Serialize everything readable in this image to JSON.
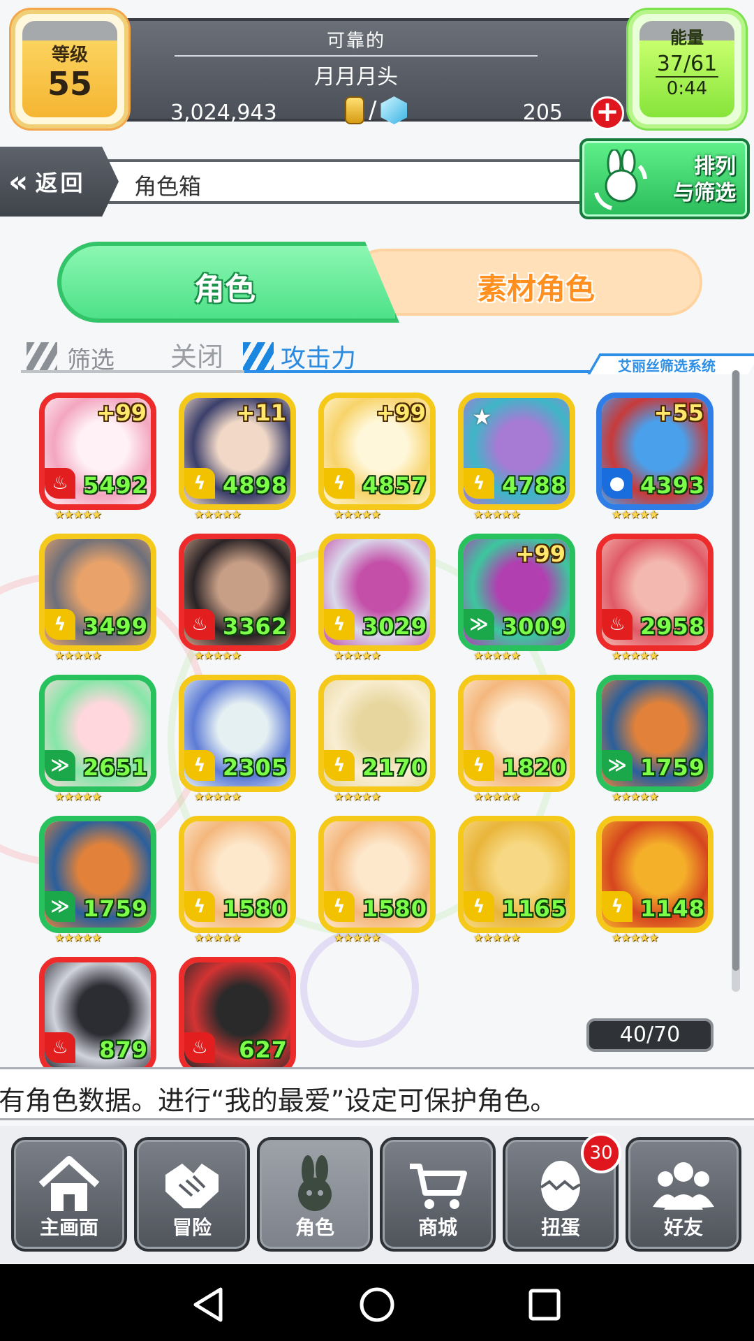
{
  "hud": {
    "level_label": "等级",
    "level_value": "55",
    "title_sub": "可靠的",
    "player_name": "月月月头",
    "coins": "3,024,943",
    "currency_sep": "/",
    "gems": "205",
    "energy_label": "能量",
    "energy_count": "37/61",
    "energy_timer": "0:44"
  },
  "header": {
    "back_label": "返回",
    "title": "角色箱",
    "sort_label_line1": "排列",
    "sort_label_line2": "与筛选"
  },
  "tabs": {
    "characters": "角色",
    "materials": "素材角色"
  },
  "filter": {
    "label": "筛选",
    "state": "关闭",
    "sort_key": "攻击力",
    "system_label": "艾丽丝筛选系统"
  },
  "characters": [
    {
      "power": "5492",
      "plus": "+99",
      "frame": "#ee2b2b",
      "element": "fire",
      "art": "#f3a6bf",
      "art2": "#fff1f5"
    },
    {
      "power": "4898",
      "plus": "+11",
      "frame": "#f5c91a",
      "element": "thunder",
      "art": "#3b3f6b",
      "art2": "#f2d9c7"
    },
    {
      "power": "4857",
      "plus": "+99",
      "frame": "#f5c91a",
      "element": "thunder",
      "art": "#f7d36a",
      "art2": "#fff7d9"
    },
    {
      "power": "4788",
      "plus": "",
      "frame": "#f5c91a",
      "element": "thunder",
      "art": "#3fb6c7",
      "art2": "#a77ad4",
      "favorite": "★"
    },
    {
      "power": "4393",
      "plus": "+55",
      "frame": "#2f7de6",
      "element": "water",
      "art": "#c83a3a",
      "art2": "#4aa0ea"
    },
    {
      "power": "3499",
      "plus": "",
      "frame": "#f5c91a",
      "element": "thunder",
      "art": "#6d6f7a",
      "art2": "#e9a36a"
    },
    {
      "power": "3362",
      "plus": "",
      "frame": "#ee2b2b",
      "element": "fire",
      "art": "#2a2326",
      "art2": "#c79e86"
    },
    {
      "power": "3029",
      "plus": "",
      "frame": "#f5c91a",
      "element": "thunder",
      "art": "#d9d9ea",
      "art2": "#c44fa8"
    },
    {
      "power": "3009",
      "plus": "+99",
      "frame": "#27c25e",
      "element": "wind",
      "art": "#3cc79e",
      "art2": "#b13fb0"
    },
    {
      "power": "2958",
      "plus": "",
      "frame": "#ee2b2b",
      "element": "fire",
      "art": "#e05a66",
      "art2": "#f3b9b0"
    },
    {
      "power": "2651",
      "plus": "",
      "frame": "#27c25e",
      "element": "wind",
      "art": "#85e6a7",
      "art2": "#ffd7dd"
    },
    {
      "power": "2305",
      "plus": "",
      "frame": "#f5c91a",
      "element": "thunder",
      "art": "#5d7bd6",
      "art2": "#e5f0f3"
    },
    {
      "power": "2170",
      "plus": "",
      "frame": "#f5c91a",
      "element": "thunder",
      "art": "#f9eed2",
      "art2": "#e7d69e"
    },
    {
      "power": "1820",
      "plus": "",
      "frame": "#f5c91a",
      "element": "thunder",
      "art": "#f4b77d",
      "art2": "#fde8cc"
    },
    {
      "power": "1759",
      "plus": "",
      "frame": "#27c25e",
      "element": "wind",
      "art": "#2a5f9c",
      "art2": "#e2823a"
    },
    {
      "power": "1759",
      "plus": "",
      "frame": "#27c25e",
      "element": "wind",
      "art": "#2a5f9c",
      "art2": "#e2823a"
    },
    {
      "power": "1580",
      "plus": "",
      "frame": "#f5c91a",
      "element": "thunder",
      "art": "#f4b77d",
      "art2": "#fde8cc"
    },
    {
      "power": "1580",
      "plus": "",
      "frame": "#f5c91a",
      "element": "thunder",
      "art": "#f4b77d",
      "art2": "#fde8cc"
    },
    {
      "power": "1165",
      "plus": "",
      "frame": "#f5c91a",
      "element": "thunder",
      "art": "#e9b53a",
      "art2": "#f7d985"
    },
    {
      "power": "1148",
      "plus": "",
      "frame": "#f5c91a",
      "element": "thunder",
      "art": "#d6451f",
      "art2": "#f5b02a"
    },
    {
      "power": "879",
      "plus": "",
      "frame": "#ee2b2b",
      "element": "fire",
      "art": "#d0d2dc",
      "art2": "#2c2c33"
    },
    {
      "power": "627",
      "plus": "",
      "frame": "#ee2b2b",
      "element": "fire",
      "art": "#d43333",
      "art2": "#2a2a2a"
    }
  ],
  "element_glyphs": {
    "fire": "♨",
    "thunder": "ϟ",
    "water": "●",
    "wind": "≫"
  },
  "element_colors": {
    "fire": "#e21e1e",
    "thunder": "#f2c200",
    "water": "#1a6ddc",
    "wind": "#1aa84a"
  },
  "rarity_stars": "★★★★★",
  "box_count": "40/70",
  "message": "有角色数据。进行“我的最爱”设定可保护角色。",
  "nav": {
    "home": "主画面",
    "adventure": "冒险",
    "characters": "角色",
    "shop": "商城",
    "gacha": "扭蛋",
    "gacha_badge": "30",
    "friends": "好友"
  }
}
